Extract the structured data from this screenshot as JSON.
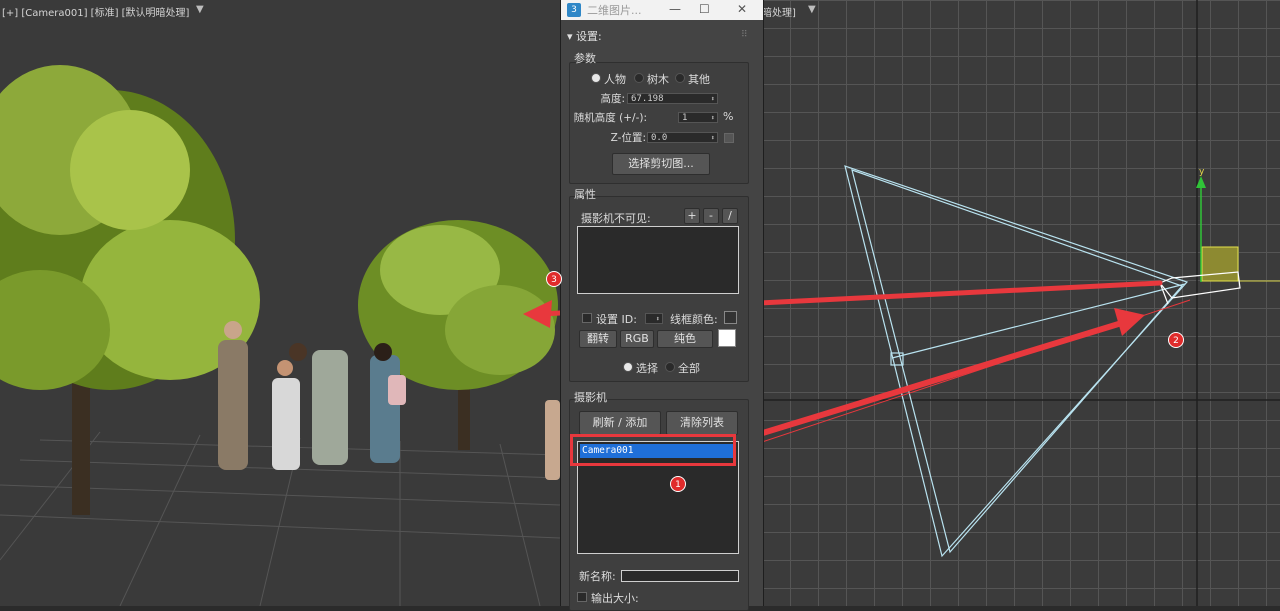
{
  "viewport_left": {
    "label": "[+] [Camera001] [标准] [默认明暗处理]"
  },
  "viewport_right": {
    "label": "暗处理]",
    "axis_label": "y"
  },
  "dialog": {
    "title": "二维图片...",
    "settings_header": "设置:",
    "params": {
      "label": "参数",
      "radio_people": "人物",
      "radio_tree": "树木",
      "radio_other": "其他",
      "height_label": "高度:",
      "height_value": "67.198",
      "random_label": "随机高度 (+/-):",
      "random_value": "1",
      "random_unit": "%",
      "z_label": "Z-位置:",
      "z_value": "0.0",
      "select_button": "选择剪切图..."
    },
    "attributes": {
      "label": "属性",
      "camera_invisible": "摄影机不可见:",
      "plus": "+",
      "minus": "-",
      "slash": "/",
      "set_id": "设置 ID:",
      "wire_color": "线框颜色:",
      "flip_button": "翻转",
      "rgb_button": "RGB",
      "solid_button": "纯色",
      "radio_select": "选择",
      "radio_all": "全部"
    },
    "camera": {
      "label": "摄影机",
      "refresh_button": "刷新 / 添加",
      "clear_button": "清除列表",
      "items": [
        "Camera001"
      ],
      "new_name_label": "新名称:",
      "output_size_label": "输出大小:"
    }
  },
  "annotations": {
    "badge1": "1",
    "badge2": "2",
    "badge3": "3",
    "color": "#e8383d"
  }
}
